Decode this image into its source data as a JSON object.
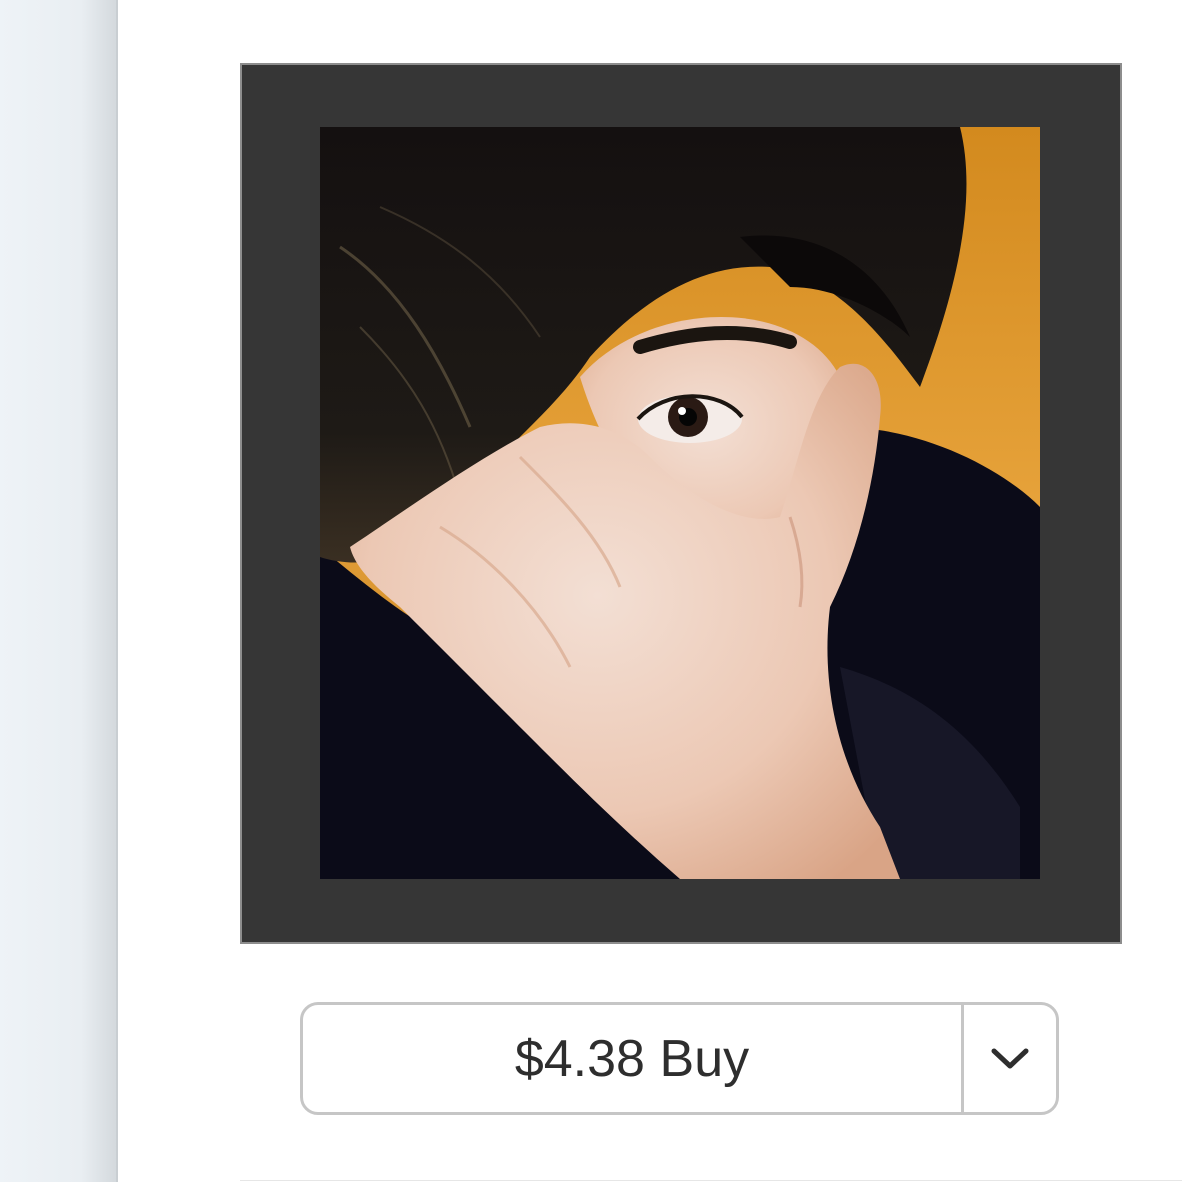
{
  "sidebar": {},
  "artwork": {
    "frame_color": "#363636",
    "background_color": "#e09a2c"
  },
  "purchase": {
    "price": "$4.38",
    "action_label": "Buy",
    "dropdown_icon": "chevron-down-icon",
    "text_color": "#2e2e2e",
    "border_color": "#c6c6c6"
  }
}
